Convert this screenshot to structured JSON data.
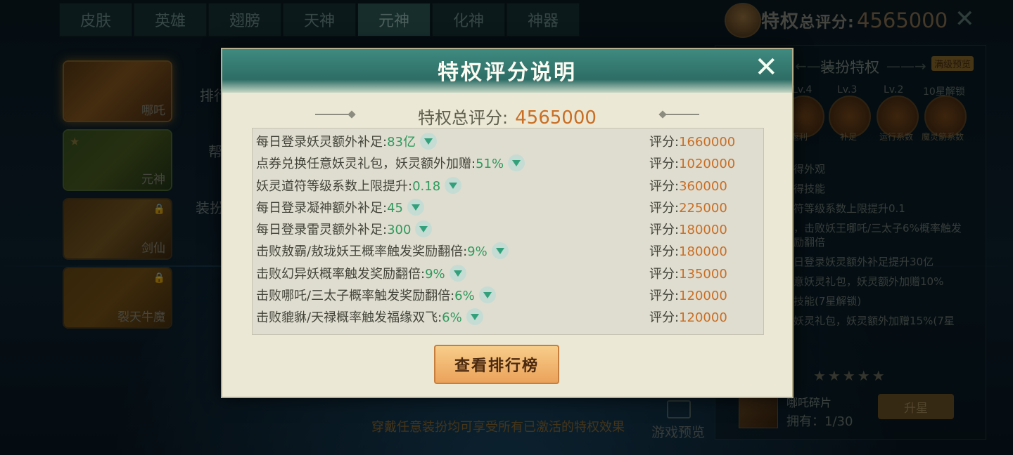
{
  "tabs": [
    "皮肤",
    "英雄",
    "翅膀",
    "天神",
    "元神",
    "化神",
    "神器"
  ],
  "header": {
    "label": "特权",
    "label_small": "总评分:",
    "score": "4565000"
  },
  "left_cards": [
    {
      "name": "哪吒"
    },
    {
      "name": "元神"
    },
    {
      "name": "剑仙"
    },
    {
      "name": "裂天牛魔"
    }
  ],
  "left_texts": [
    "排行",
    "帮",
    "装扮"
  ],
  "right_panel": {
    "title": "装扮特权",
    "badge": "满级预览",
    "levels": [
      "Lv.4",
      "Lv.3",
      "Lv.2",
      "10星解锁"
    ],
    "orb_labels": [
      "返利",
      "补足",
      "运行系数",
      "魔灵箭系数"
    ],
    "lines": [
      "得外观",
      "得技能",
      "符等级系数上限提升0.1",
      "，击败妖王哪吒/三太子6%概率触发",
      "励翻倍",
      "日登录妖灵额外补足提升30亿",
      "意妖灵礼包，妖灵额外加赠10%",
      "技能(7星解锁)",
      "妖灵礼包，妖灵额外加赠15%(7星"
    ],
    "fragment_name": "哪吒碎片",
    "fragment_owned": "拥有：1/30",
    "upgrade_label": "升星"
  },
  "bottom_text": "穿戴任意装扮均可享受所有已激活的特权效果",
  "preview_label": "游戏预览",
  "modal": {
    "title": "特权评分说明",
    "total_label": "特权总评分:",
    "total_value": "4565000",
    "score_prefix": "评分:",
    "rows": [
      {
        "desc": "每日登录妖灵额外补足:",
        "value": "83亿",
        "score": "1660000"
      },
      {
        "desc": "点券兑换任意妖灵礼包，妖灵额外加赠:",
        "value": "51%",
        "score": "1020000"
      },
      {
        "desc": "妖灵道符等级系数上限提升:",
        "value": "0.18",
        "score": "360000"
      },
      {
        "desc": "每日登录凝神额外补足:",
        "value": "45",
        "score": "225000"
      },
      {
        "desc": "每日登录雷灵额外补足:",
        "value": "300",
        "score": "180000"
      },
      {
        "desc": "击败敖霸/敖珑妖王概率触发奖励翻倍:",
        "value": "9%",
        "score": "180000"
      },
      {
        "desc": "击败幻异妖概率触发奖励翻倍:",
        "value": "9%",
        "score": "135000"
      },
      {
        "desc": "击败哪吒/三太子概率触发奖励翻倍:",
        "value": "6%",
        "score": "120000"
      },
      {
        "desc": "击败貔貅/天禄概率触发福缘双飞:",
        "value": "6%",
        "score": "120000"
      }
    ],
    "rank_button": "查看排行榜"
  }
}
